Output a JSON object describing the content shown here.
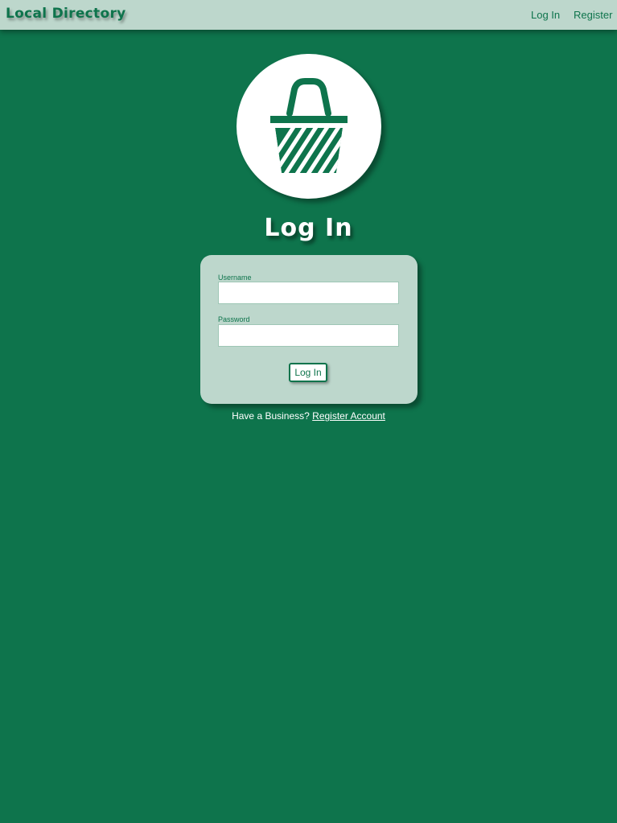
{
  "navbar": {
    "brand": "Local Directory",
    "links": {
      "login": "Log In",
      "register": "Register"
    }
  },
  "logo": {
    "icon": "shopping-basket-icon"
  },
  "page": {
    "title": "Log In"
  },
  "form": {
    "username_label": "Username",
    "username_value": "",
    "password_label": "Password",
    "password_value": "",
    "submit_label": "Log In"
  },
  "footer": {
    "prompt": "Have a Business?",
    "register_link": "Register Account"
  },
  "colors": {
    "brand_green": "#0e744c",
    "light_green": "#bdd7cc",
    "white": "#ffffff"
  }
}
